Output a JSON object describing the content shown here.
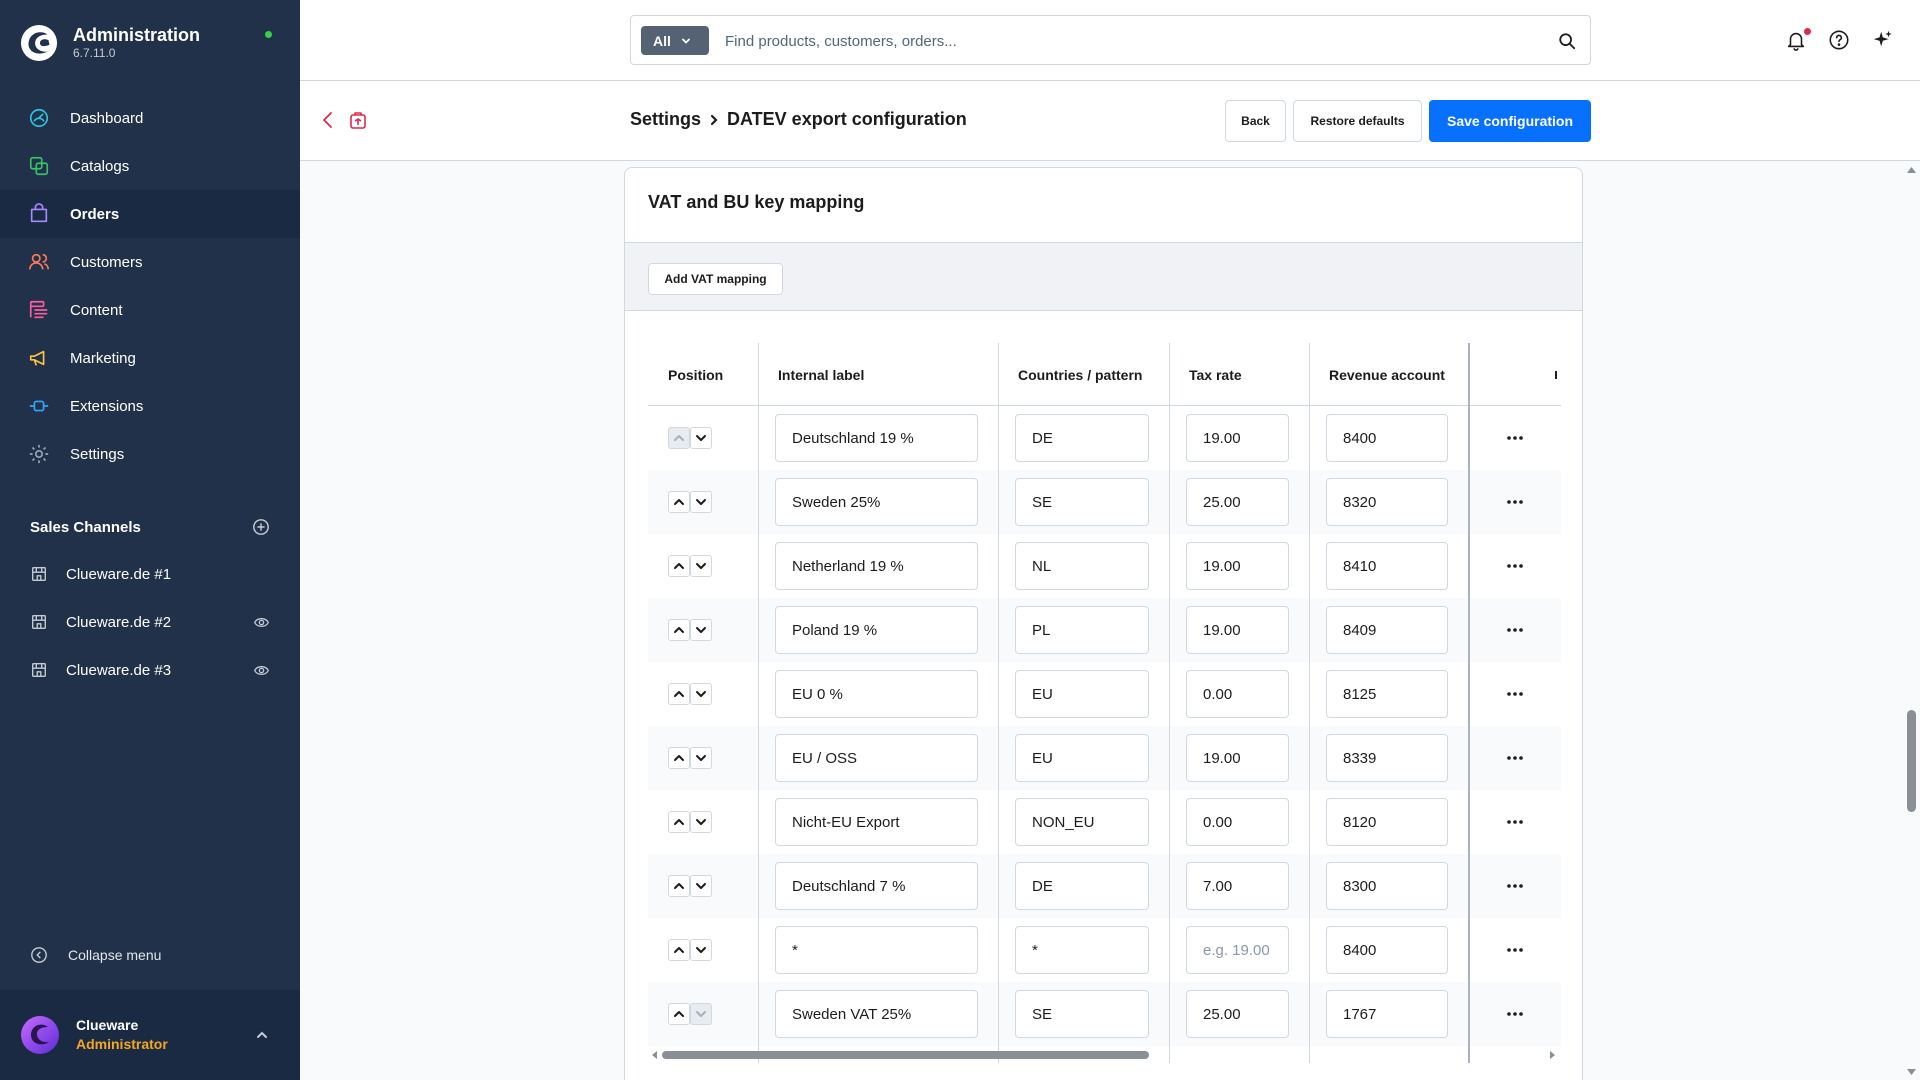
{
  "app": {
    "title": "Administration",
    "version": "6.7.11.0"
  },
  "sidebar": {
    "nav": [
      {
        "label": "Dashboard",
        "icon": "dashboard-icon"
      },
      {
        "label": "Catalogs",
        "icon": "catalog-icon"
      },
      {
        "label": "Orders",
        "icon": "orders-icon"
      },
      {
        "label": "Customers",
        "icon": "customers-icon"
      },
      {
        "label": "Content",
        "icon": "content-icon"
      },
      {
        "label": "Marketing",
        "icon": "marketing-icon"
      },
      {
        "label": "Extensions",
        "icon": "extensions-icon"
      },
      {
        "label": "Settings",
        "icon": "settings-icon"
      }
    ],
    "active_item": "Orders",
    "sales_channels_title": "Sales Channels",
    "sales_channels": [
      {
        "label": "Clueware.de #1",
        "visible_icon": false
      },
      {
        "label": "Clueware.de #2",
        "visible_icon": true
      },
      {
        "label": "Clueware.de #3",
        "visible_icon": true
      }
    ],
    "collapse_label": "Collapse menu",
    "user": {
      "name": "Clueware",
      "role": "Administrator"
    }
  },
  "search": {
    "type_label": "All",
    "placeholder": "Find products, customers, orders..."
  },
  "header": {
    "breadcrumb_parent": "Settings",
    "breadcrumb_current": "DATEV export configuration",
    "back_label": "Back",
    "restore_label": "Restore defaults",
    "save_label": "Save configuration"
  },
  "card": {
    "title": "VAT and BU key mapping",
    "add_button_label": "Add VAT mapping"
  },
  "table": {
    "columns": [
      "Position",
      "Internal label",
      "Countries / pattern",
      "Tax rate",
      "Revenue account"
    ],
    "tax_rate_placeholder": "e.g. 19.00",
    "rows": [
      {
        "label": "Deutschland 19 %",
        "country": "DE",
        "tax": "19.00",
        "account": "8400",
        "up_disabled": true,
        "down_disabled": false
      },
      {
        "label": "Sweden 25%",
        "country": "SE",
        "tax": "25.00",
        "account": "8320",
        "up_disabled": false,
        "down_disabled": false
      },
      {
        "label": "Netherland 19 %",
        "country": "NL",
        "tax": "19.00",
        "account": "8410",
        "up_disabled": false,
        "down_disabled": false
      },
      {
        "label": "Poland 19 %",
        "country": "PL",
        "tax": "19.00",
        "account": "8409",
        "up_disabled": false,
        "down_disabled": false
      },
      {
        "label": "EU 0 %",
        "country": "EU",
        "tax": "0.00",
        "account": "8125",
        "up_disabled": false,
        "down_disabled": false
      },
      {
        "label": "EU / OSS",
        "country": "EU",
        "tax": "19.00",
        "account": "8339",
        "up_disabled": false,
        "down_disabled": false
      },
      {
        "label": "Nicht-EU Export",
        "country": "NON_EU",
        "tax": "0.00",
        "account": "8120",
        "up_disabled": false,
        "down_disabled": false
      },
      {
        "label": "Deutschland 7 %",
        "country": "DE",
        "tax": "7.00",
        "account": "8300",
        "up_disabled": false,
        "down_disabled": false
      },
      {
        "label": "*",
        "country": "*",
        "tax": "",
        "account": "8400",
        "up_disabled": false,
        "down_disabled": false
      },
      {
        "label": "Sweden VAT 25%",
        "country": "SE",
        "tax": "25.00",
        "account": "1767",
        "up_disabled": false,
        "down_disabled": true
      }
    ]
  },
  "colors": {
    "sidebar_bg": "#213149",
    "primary": "#0870ff",
    "status_online": "#37d046",
    "notification": "#de294c",
    "user_role": "#f5a623"
  }
}
